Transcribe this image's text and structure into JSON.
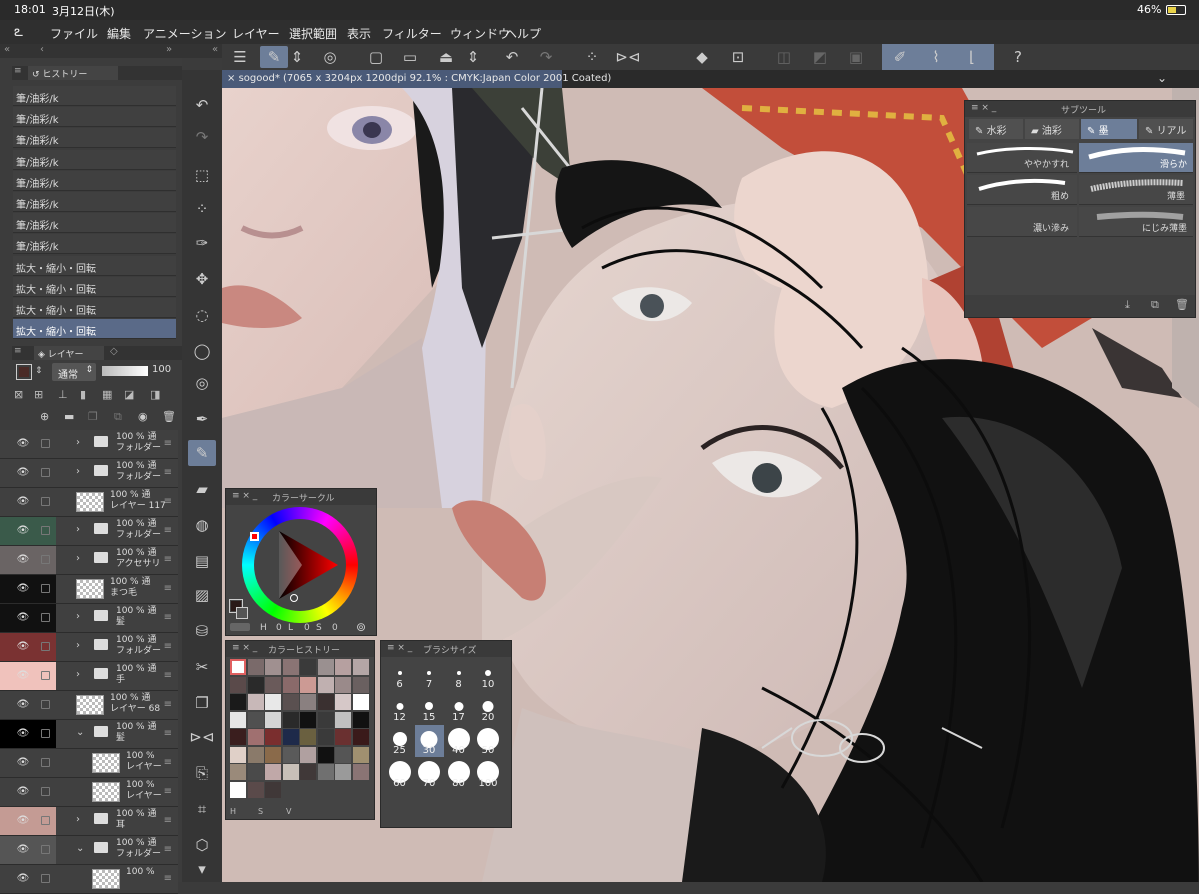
{
  "status": {
    "time": "18:01",
    "date": "3月12日(木)",
    "battery": "46%"
  },
  "menu": [
    "ファイル",
    "編集",
    "アニメーション",
    "レイヤー",
    "選択範囲",
    "表示",
    "フィルター",
    "ウィンドウ",
    "ヘルプ"
  ],
  "history_tab": "ヒストリー",
  "history": [
    "筆/油彩/k",
    "筆/油彩/k",
    "筆/油彩/k",
    "筆/油彩/k",
    "筆/油彩/k",
    "筆/油彩/k",
    "筆/油彩/k",
    "筆/油彩/k",
    "拡大・縮小・回転",
    "拡大・縮小・回転",
    "拡大・縮小・回転",
    "拡大・縮小・回転"
  ],
  "layer_tab": "レイヤー",
  "blend_mode": "通常",
  "opacity": "100",
  "layers": [
    {
      "pct": "100 % 通",
      "name": "フォルダー",
      "type": "folder",
      "color": "#404040"
    },
    {
      "pct": "100 % 通",
      "name": "フォルダー",
      "type": "folder",
      "color": "#404040"
    },
    {
      "pct": "100 % 通",
      "name": "レイヤー 117",
      "type": "raster",
      "color": "#404040"
    },
    {
      "pct": "100 % 通",
      "name": "フォルダー",
      "type": "folder",
      "color": "#3a5a4a"
    },
    {
      "pct": "100 % 通",
      "name": "アクセサリ",
      "type": "folder",
      "color": "#6a6464"
    },
    {
      "pct": "100 % 通",
      "name": "まつ毛",
      "type": "raster",
      "color": "#111111"
    },
    {
      "pct": "100 % 通",
      "name": "髪",
      "type": "folder",
      "color": "#111111"
    },
    {
      "pct": "100 % 通",
      "name": "フォルダー",
      "type": "folder",
      "color": "#7a3232"
    },
    {
      "pct": "100 % 通",
      "name": "手",
      "type": "folder",
      "color": "#f0c2bc"
    },
    {
      "pct": "100 % 通",
      "name": "レイヤー 68",
      "type": "raster",
      "color": "#404040"
    },
    {
      "pct": "100 % 通",
      "name": "髪",
      "type": "folder-open",
      "color": "#000000"
    },
    {
      "pct": "100 %",
      "name": "レイヤー",
      "type": "raster-sub",
      "color": "#404040"
    },
    {
      "pct": "100 %",
      "name": "レイヤー",
      "type": "raster-sub",
      "color": "#404040"
    },
    {
      "pct": "100 % 通",
      "name": "耳",
      "type": "folder",
      "color": "#c49b94"
    },
    {
      "pct": "100 % 通",
      "name": "フォルダー",
      "type": "folder-open",
      "color": "#555555"
    },
    {
      "pct": "100 %",
      "name": "",
      "type": "raster-sub",
      "color": "#404040"
    }
  ],
  "document_title": "sogood* (7065 x 3204px 1200dpi 92.1% : CMYK:Japan Color 2001 Coated)",
  "subtool": {
    "title": "サブツール",
    "tabs": [
      "水彩",
      "油彩",
      "墨",
      "リアル"
    ],
    "brushes": [
      "ややかすれ",
      "滑らか",
      "粗め",
      "薄墨",
      "濃い滲み",
      "にじみ薄墨"
    ]
  },
  "color_circle": {
    "title": "カラーサークル",
    "h_label": "H",
    "h": "0",
    "l_label": "L",
    "l": "0",
    "s_label": "S",
    "s": "0",
    "current_color": "#2a1a18"
  },
  "color_history": {
    "title": "カラーヒストリー",
    "footer": [
      "H",
      "S",
      "V"
    ],
    "swatches": [
      "#ffffff",
      "#7a6a6a",
      "#a09090",
      "#8a7474",
      "#3a3a3a",
      "#9a9090",
      "#b6a0a0",
      "#b4a6a6",
      "#5a4a4a",
      "#2a2a2a",
      "#6a5a5a",
      "#8a6a6a",
      "#cc9a94",
      "#c0b0b0",
      "#9a8a8a",
      "#6a6060",
      "#1a1a1a",
      "#c8b8b8",
      "#e8e8e8",
      "#5a5050",
      "#8a8080",
      "#3a3030",
      "#d6c8c8",
      "#ffffff",
      "#e6e6e6",
      "#505050",
      "#d4d4d4",
      "#2a2a2a",
      "#111111",
      "#3a3a3a",
      "#c0c0c0",
      "#111111",
      "#3a1e1e",
      "#a07070",
      "#7a2e2e",
      "#1e2a4a",
      "#6a6040",
      "#3a3a3a",
      "#6a3030",
      "#3a1a1a",
      "#e0d0c8",
      "#8a7a6a",
      "#8a6a4a",
      "#5a5a5a",
      "#b0a0a0",
      "#111111",
      "#555555",
      "#a09070",
      "#9a8a7a",
      "#4a4a4a",
      "#c0a8a8",
      "#c8c0b8",
      "#403838",
      "#707070",
      "#9a9a9a",
      "#8a7474",
      "#ffffff",
      "#5a4a4a",
      "#403838"
    ]
  },
  "brush_size": {
    "title": "ブラシサイズ",
    "sizes": [
      "6",
      "7",
      "8",
      "10",
      "12",
      "15",
      "17",
      "20",
      "25",
      "30",
      "40",
      "50",
      "60",
      "70",
      "80",
      "100"
    ],
    "selected": "30"
  }
}
